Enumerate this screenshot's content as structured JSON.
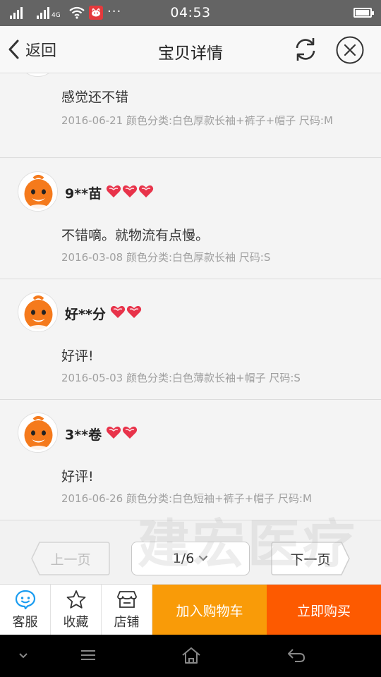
{
  "status": {
    "time": "04:53",
    "network": "4G",
    "battery_level": 0.85
  },
  "nav": {
    "back_label": "返回",
    "title": "宝贝详情"
  },
  "reviews": [
    {
      "user": "",
      "hearts": 0,
      "text": "感觉还不错",
      "meta": "2016-06-21 颜色分类:白色厚款长袖+裤子+帽子 尺码:M"
    },
    {
      "user": "9**苗",
      "hearts": 3,
      "text": "不错嘀。就物流有点慢。",
      "meta": "2016-03-08 颜色分类:白色厚款长袖 尺码:S"
    },
    {
      "user": "好**分",
      "hearts": 2,
      "text": "好评!",
      "meta": "2016-05-03 颜色分类:白色薄款长袖+帽子 尺码:S"
    },
    {
      "user": "3**卷",
      "hearts": 2,
      "text": "好评!",
      "meta": "2016-06-26 颜色分类:白色短袖+裤子+帽子 尺码:M"
    }
  ],
  "watermark": "建宏医疗",
  "pager": {
    "prev": "上一页",
    "page": "1/6",
    "next": "下一页"
  },
  "actions": {
    "service": "客服",
    "favorite": "收藏",
    "store": "店铺",
    "add_to_cart": "加入购物车",
    "buy_now": "立即购买"
  },
  "colors": {
    "cart": "#f99b08",
    "buy": "#fd5a00",
    "service_icon": "#1a9cf0",
    "heart": "#e8334a"
  }
}
